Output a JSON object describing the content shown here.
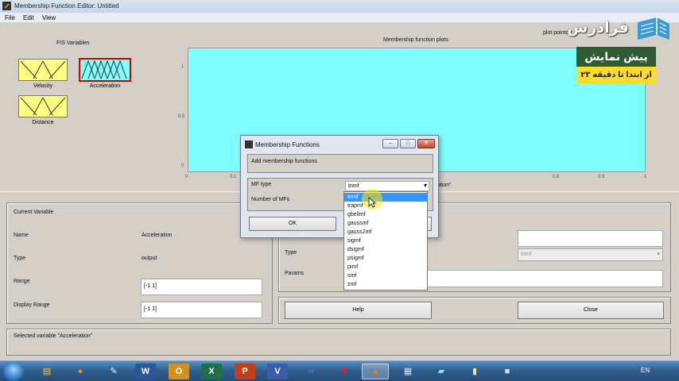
{
  "window": {
    "title": "Membership Function Editor: Untitled"
  },
  "menu": [
    "File",
    "Edit",
    "View"
  ],
  "fis": {
    "section_title": "FIS Variables",
    "inputs": [
      {
        "label": "Velocity"
      },
      {
        "label": "Distance"
      }
    ],
    "output": {
      "label": "Acceleration"
    }
  },
  "plot": {
    "title": "Membership function plots",
    "points_label": "plot points:",
    "y_ticks": [
      "1",
      "0.5",
      "0"
    ],
    "x_ticks": [
      "0",
      "0.1",
      "0.8",
      "0.9",
      "1"
    ],
    "x_label_fragment": "ation\"",
    "bg_color": "#80ffff"
  },
  "current_variable": {
    "title": "Current Variable",
    "name_label": "Name",
    "name_value": "Acceleration",
    "type_label": "Type",
    "type_value": "output",
    "range_label": "Range",
    "range_value": "[-1 1]",
    "display_range_label": "Display Range",
    "display_range_value": "[-1 1]"
  },
  "mf_panel": {
    "type_label": "Type",
    "type_value": "trimf",
    "params_label": "Params",
    "help_label": "Help",
    "close_label": "Close"
  },
  "status": {
    "text": "Selected variable \"Acceleration\""
  },
  "dialog": {
    "title": "Membership Functions",
    "heading": "Add membership functions",
    "mf_type_label": "MF type",
    "mf_type_value": "trimf",
    "num_mfs_label": "Number of MFs",
    "ok_label": "OK"
  },
  "dropdown": {
    "options": [
      "trimf",
      "trapmf",
      "gbellmf",
      "gaussmf",
      "gauss2mf",
      "sigmf",
      "dsigmf",
      "psigmf",
      "pimf",
      "smf",
      "zmf"
    ],
    "selected": "trimf"
  },
  "watermark": {
    "logo_text": "فرادرس",
    "banner_top": "پیش نمایش",
    "banner_bottom": "از ابتدا تا دقیقه ۲۳",
    "banner_green": "#2f5a34",
    "banner_yellow": "#ffdc25"
  },
  "taskbar": {
    "language": "EN",
    "apps": [
      "explorer-icon",
      "firefox-icon",
      "pen-icon",
      "word-icon",
      "outlook-icon",
      "excel-icon",
      "powerpoint-icon",
      "visio-icon",
      "infinity-icon",
      "star-icon",
      "matlab-icon",
      "calculator-icon",
      "notes-icon",
      "media-icon",
      "camera-icon"
    ]
  }
}
